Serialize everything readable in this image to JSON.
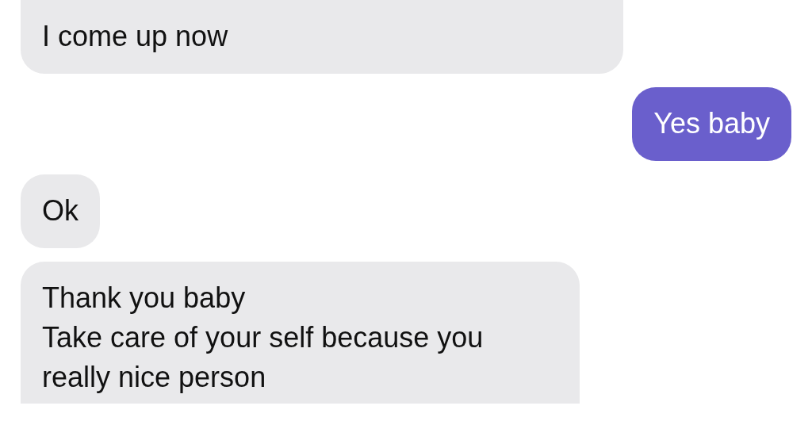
{
  "messages": [
    {
      "kind": "incoming",
      "text": "I come up now"
    },
    {
      "kind": "outgoing",
      "text": "Yes baby"
    },
    {
      "kind": "incoming",
      "text": "Ok"
    },
    {
      "kind": "incoming",
      "text": "Thank you baby\nTake care of your self because you\nreally nice person"
    }
  ]
}
